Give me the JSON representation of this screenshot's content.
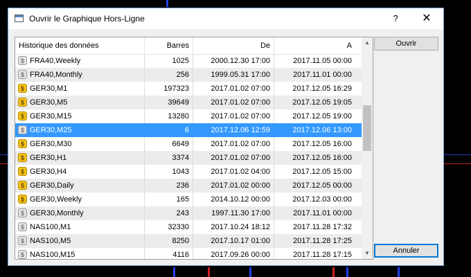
{
  "window": {
    "title": "Ouvrir le Graphique Hors-Ligne",
    "help_label": "?",
    "close_label": "✕"
  },
  "buttons": {
    "open": "Ouvrir",
    "cancel": "Annuler"
  },
  "colors": {
    "selection": "#3399ff",
    "gold_icon": "#f3c21c",
    "grey_icon": "#e3e3e3",
    "background": "#000000"
  },
  "table": {
    "columns": [
      "Historique des données",
      "Barres",
      "De",
      "A"
    ],
    "rows": [
      {
        "name": "FRA40,Weekly",
        "bars": "1025",
        "from": "2000.12.30 17:00",
        "to": "2017.11.05 00:00",
        "icon": "grey"
      },
      {
        "name": "FRA40,Monthly",
        "bars": "256",
        "from": "1999.05.31 17:00",
        "to": "2017.11.01 00:00",
        "icon": "grey"
      },
      {
        "name": "GER30,M1",
        "bars": "197323",
        "from": "2017.01.02 07:00",
        "to": "2017.12.05 16:29",
        "icon": "gold"
      },
      {
        "name": "GER30,M5",
        "bars": "39649",
        "from": "2017.01.02 07:00",
        "to": "2017.12.05 19:05",
        "icon": "gold"
      },
      {
        "name": "GER30,M15",
        "bars": "13280",
        "from": "2017.01.02 07:00",
        "to": "2017.12.05 19:00",
        "icon": "gold"
      },
      {
        "name": "GER30,M25",
        "bars": "6",
        "from": "2017.12.06 12:59",
        "to": "2017.12.06 13:00",
        "icon": "grey",
        "selected": true
      },
      {
        "name": "GER30,M30",
        "bars": "6649",
        "from": "2017.01.02 07:00",
        "to": "2017.12.05 16:00",
        "icon": "gold"
      },
      {
        "name": "GER30,H1",
        "bars": "3374",
        "from": "2017.01.02 07:00",
        "to": "2017.12.05 16:00",
        "icon": "gold"
      },
      {
        "name": "GER30,H4",
        "bars": "1043",
        "from": "2017.01.02 04:00",
        "to": "2017.12.05 15:00",
        "icon": "gold"
      },
      {
        "name": "GER30,Daily",
        "bars": "236",
        "from": "2017.01.02 00:00",
        "to": "2017.12.05 00:00",
        "icon": "gold"
      },
      {
        "name": "GER30,Weekly",
        "bars": "165",
        "from": "2014.10.12 00:00",
        "to": "2017.12.03 00:00",
        "icon": "gold"
      },
      {
        "name": "GER30,Monthly",
        "bars": "243",
        "from": "1997.11.30 17:00",
        "to": "2017.11.01 00:00",
        "icon": "grey"
      },
      {
        "name": "NAS100,M1",
        "bars": "32330",
        "from": "2017.10.24 18:12",
        "to": "2017.11.28 17:32",
        "icon": "grey"
      },
      {
        "name": "NAS100,M5",
        "bars": "8250",
        "from": "2017.10.17 01:00",
        "to": "2017.11.28 17:25",
        "icon": "grey"
      },
      {
        "name": "NAS100,M15",
        "bars": "4116",
        "from": "2017.09.26 00:00",
        "to": "2017.11.28 17:15",
        "icon": "grey"
      }
    ]
  }
}
